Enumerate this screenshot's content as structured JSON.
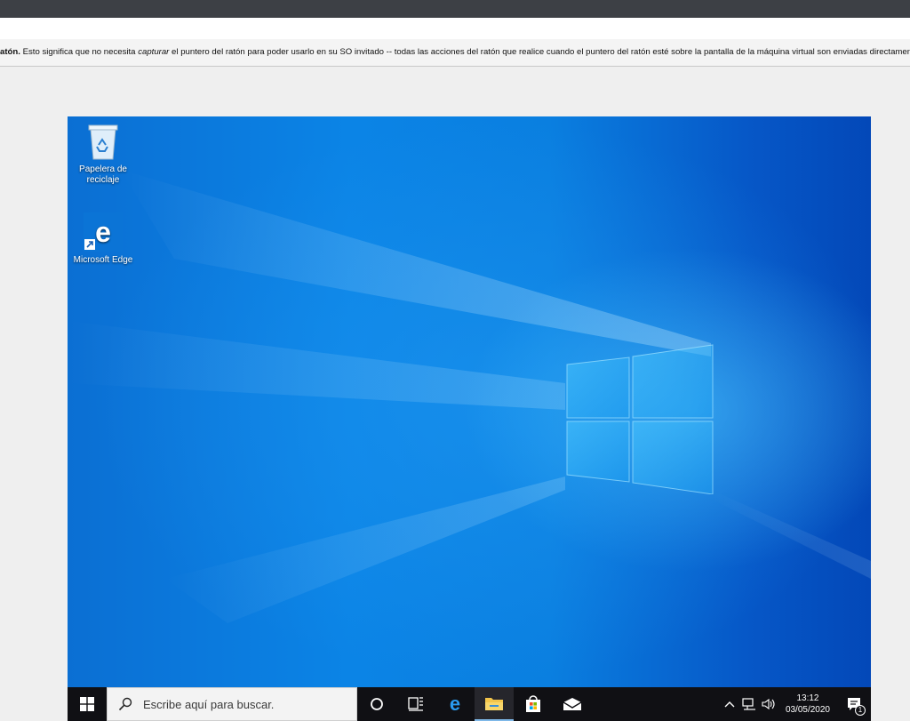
{
  "notice": {
    "bold": "atón.",
    "pre": " Esto significa que no necesita ",
    "italic": "capturar",
    "post": " el puntero del ratón para poder usarlo en su SO invitado -- todas las acciones del ratón que realice cuando el puntero del ratón esté sobre la pantalla de la máquina virtual son enviadas directamen"
  },
  "desktop": {
    "icons": [
      {
        "label": "Papelera de reciclaje",
        "icon": "recycle-bin-icon"
      },
      {
        "label": "Microsoft Edge",
        "icon": "edge-icon"
      }
    ]
  },
  "taskbar": {
    "search_placeholder": "Escribe aquí para buscar.",
    "apps": [
      {
        "name": "cortana",
        "icon": "cortana-icon"
      },
      {
        "name": "task-view",
        "icon": "task-view-icon"
      },
      {
        "name": "edge",
        "icon": "edge-icon"
      },
      {
        "name": "file-explorer",
        "icon": "folder-icon"
      },
      {
        "name": "store",
        "icon": "store-icon"
      },
      {
        "name": "mail",
        "icon": "mail-icon"
      }
    ],
    "clock": {
      "time": "13:12",
      "date": "03/05/2020"
    },
    "notifications": "1"
  },
  "colors": {
    "accent": "#0a7fe0",
    "taskbar": "#101014"
  }
}
